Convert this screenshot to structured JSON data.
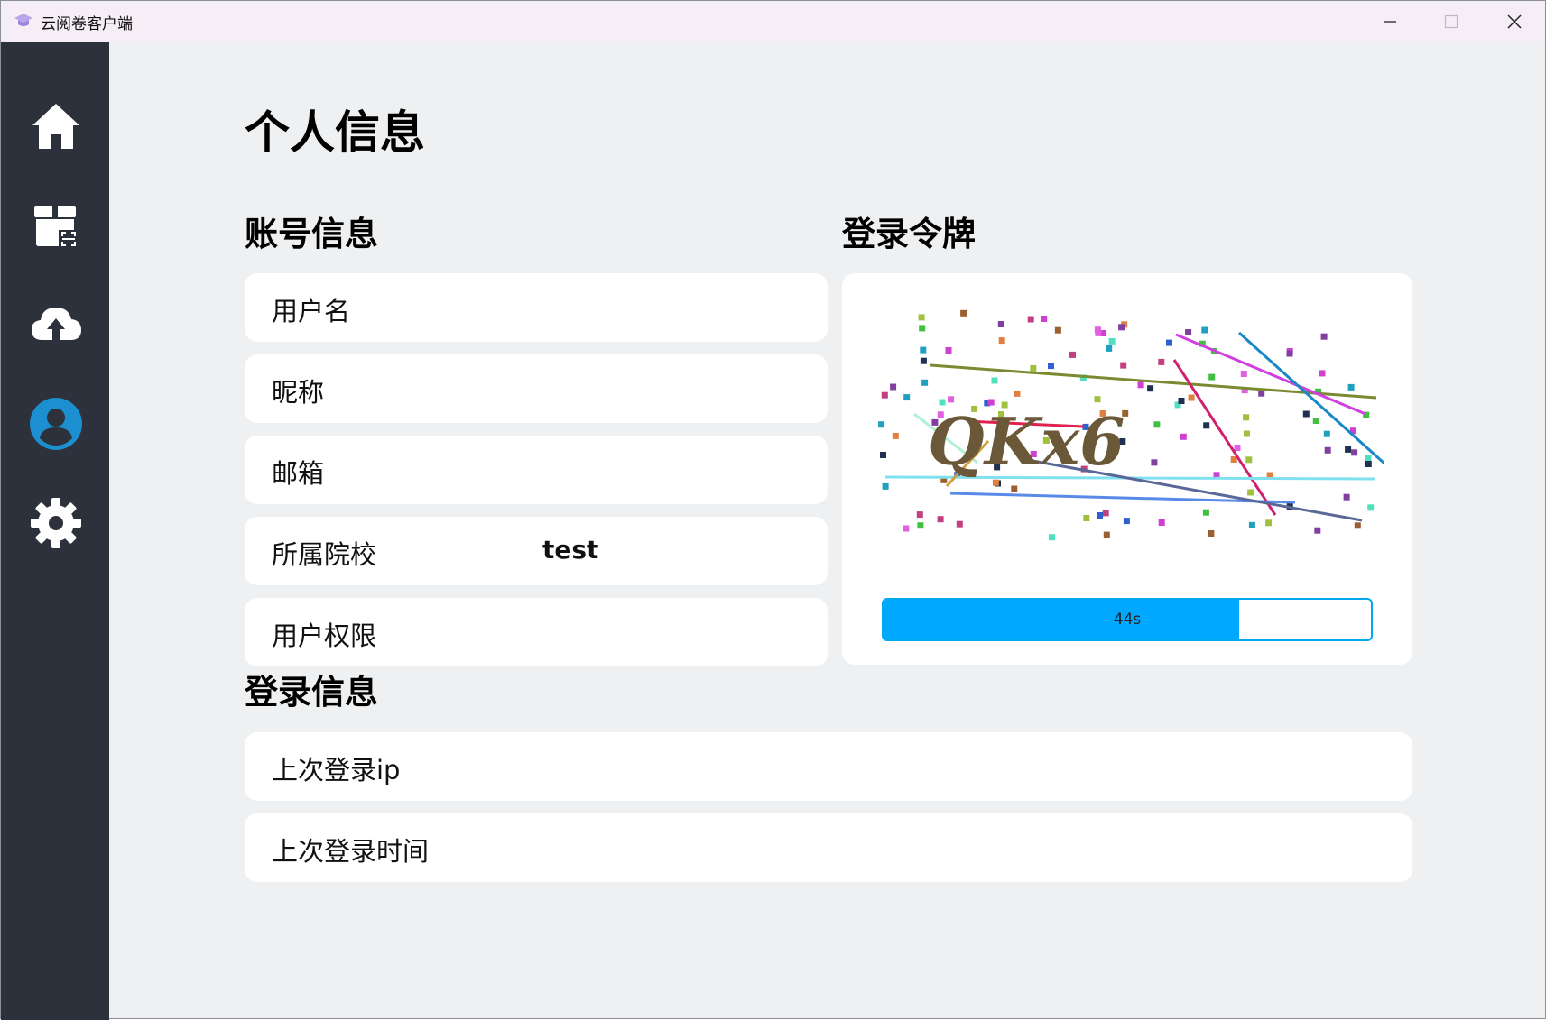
{
  "window": {
    "title": "云阅卷客户端",
    "icon": "graduation-cap-icon",
    "controls": [
      "minimize-icon",
      "maximize-icon",
      "close-icon"
    ]
  },
  "sidebar": {
    "items": [
      {
        "name": "home",
        "icon": "home-icon",
        "active": false
      },
      {
        "name": "scan",
        "icon": "scan-package-icon",
        "active": false
      },
      {
        "name": "upload",
        "icon": "cloud-upload-icon",
        "active": false
      },
      {
        "name": "profile",
        "icon": "user-icon",
        "active": true
      },
      {
        "name": "settings",
        "icon": "gear-icon",
        "active": false
      }
    ]
  },
  "page": {
    "title": "个人信息",
    "account_section": {
      "title": "账号信息",
      "fields": [
        {
          "label": "用户名",
          "value": ""
        },
        {
          "label": "昵称",
          "value": ""
        },
        {
          "label": "邮箱",
          "value": ""
        },
        {
          "label": "所属院校",
          "value": "test"
        },
        {
          "label": "用户权限",
          "value": ""
        }
      ]
    },
    "token_section": {
      "title": "登录令牌",
      "captcha_text": "QKx6",
      "countdown_label": "44s",
      "countdown_fraction": 0.73
    },
    "login_section": {
      "title": "登录信息",
      "fields": [
        {
          "label": "上次登录ip",
          "value": ""
        },
        {
          "label": "上次登录时间",
          "value": ""
        }
      ]
    }
  },
  "colors": {
    "sidebar": "#2d313b",
    "accent": "#00a8ff",
    "background": "#eef0f1"
  }
}
